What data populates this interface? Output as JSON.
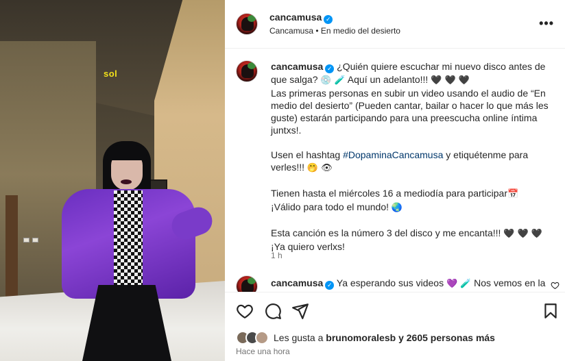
{
  "media": {
    "overlay_text": "sol"
  },
  "header": {
    "username": "cancamusa",
    "verified": "✓",
    "subtitle_author": "Cancamusa",
    "subtitle_sep": " • ",
    "subtitle_song": "En medio del desierto",
    "more_label": "•••"
  },
  "caption": {
    "username": "cancamusa",
    "verified": "✓",
    "line1": "¿Quién quiere escuchar mi nuevo disco antes de",
    "line2_pre": "que salga? ",
    "line2_emoji1": "💿",
    "line2_emoji2": "🧪",
    "line2_post": " Aquí un adelanto!!! ",
    "line2_hearts": "🖤 🖤 🖤",
    "para1": "Las primeras personas en subir un video usando el audio de “En medio del desierto” (Pueden cantar, bailar o hacer lo que más les guste) estarán participando para una preescucha online íntima juntxs!.",
    "para2_pre": "Usen el hashtag ",
    "hashtag": "#DopaminaCancamusa",
    "para2_post": " y etiquétenme para verles!!! ",
    "para2_emojis": "🤭 👁",
    "para3_line1": "Tienen hasta el miércoles 16 a mediodía para participar",
    "para3_emoji": "📅",
    "para3_line2": "¡Válido para todo el mundo! ",
    "para3_emoji2": "🌏",
    "para4_line1": "Esta canción es la número 3 del disco y me encanta!!! ",
    "para4_hearts": "🖤 🖤 🖤",
    "para4_line2": "¡Ya quiero verlxs!",
    "time": "1 h"
  },
  "comment2": {
    "username": "cancamusa",
    "verified": "✓",
    "text_pre": "Ya esperando sus videos ",
    "emoji1": "💜",
    "emoji2": "🧪",
    "text_post": " Nos vemos en la"
  },
  "actions": {
    "like_icon": "heart-icon",
    "comment_icon": "comment-icon",
    "share_icon": "share-icon",
    "save_icon": "bookmark-icon"
  },
  "likes": {
    "prefix": "Les gusta a ",
    "user": "brunomoralesb",
    "middle": " y ",
    "count": "2605 personas más"
  },
  "posted": "Hace una hora",
  "colors": {
    "verified": "#0095f6",
    "hashtag": "#00376b",
    "muted": "#737373"
  }
}
